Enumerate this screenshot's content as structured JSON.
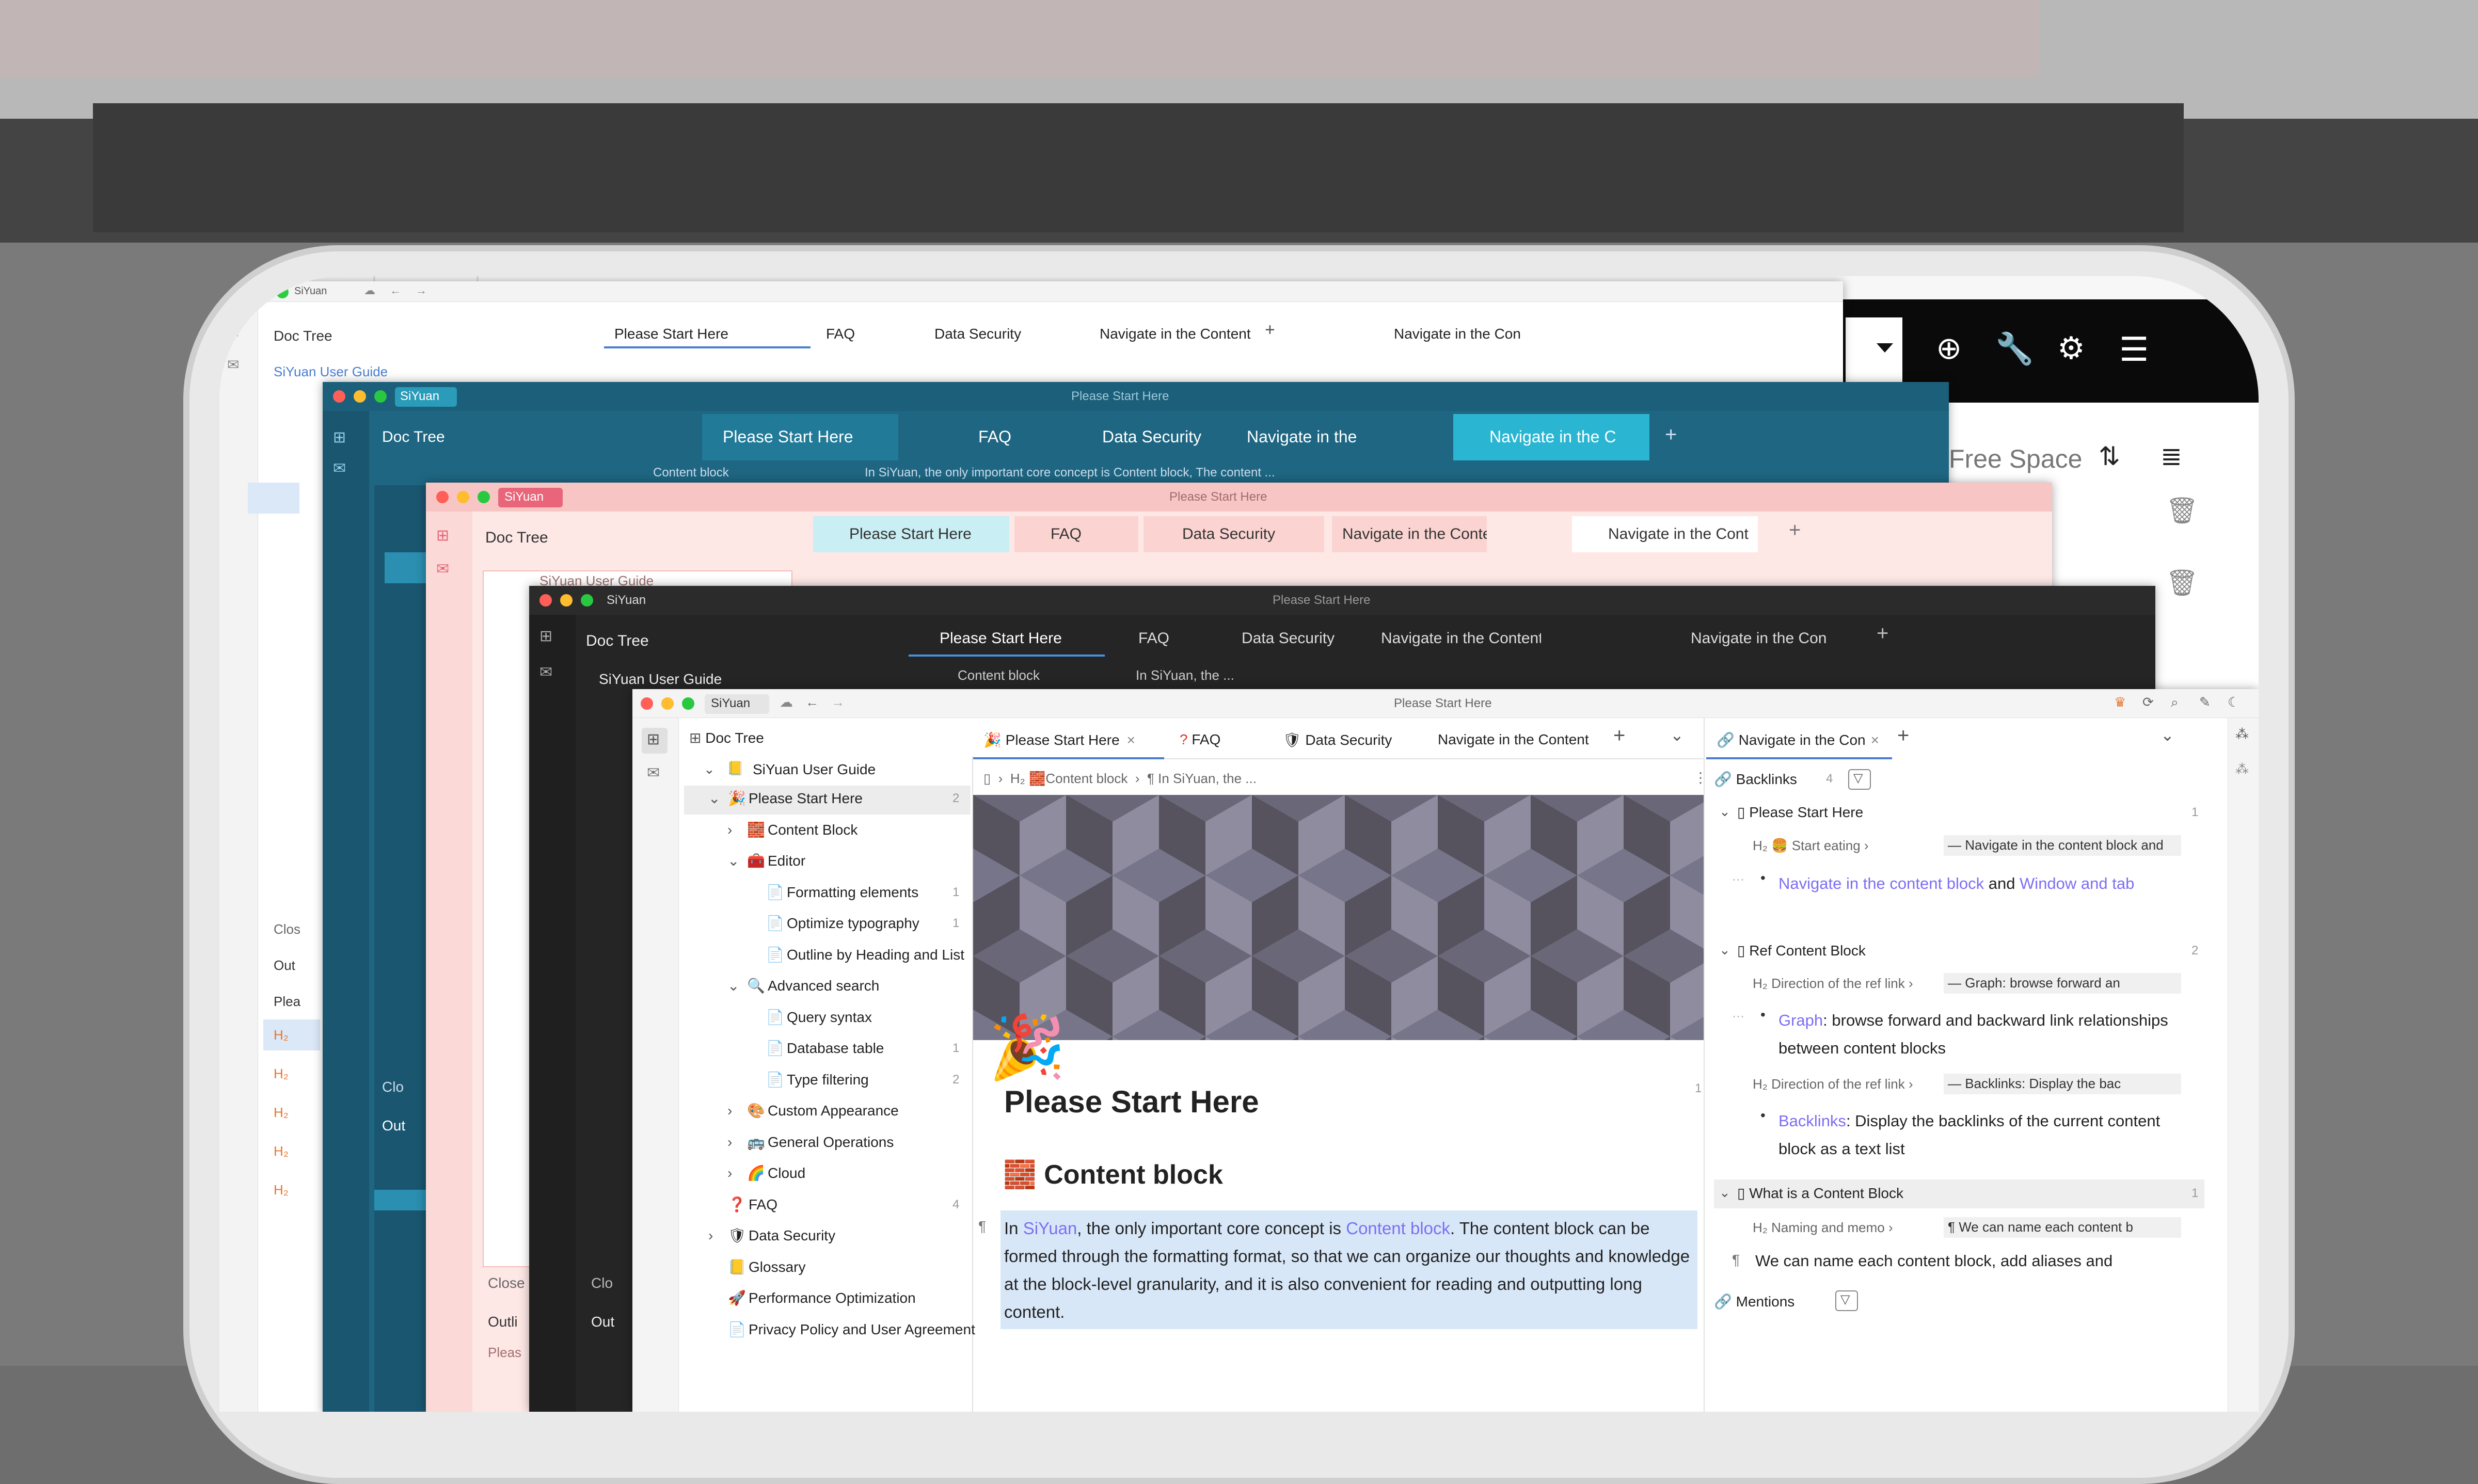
{
  "app": {
    "name": "SiYuan",
    "window_title": "Please Start Here"
  },
  "colors": {
    "teal_theme": "#1c5f7a",
    "pink_theme": "#f7c6c4",
    "dark_theme": "#2b2b2b",
    "light_theme": "#f6f6f6",
    "accent": "#7c6ef5",
    "link": "#7c6ef5",
    "heading_orange": "#e8762d"
  },
  "icons": {
    "doc_tree": "doc-tree-icon",
    "inbox": "inbox-icon",
    "backlinks": "link-icon",
    "filter": "filter-icon",
    "close": "close-icon",
    "plus": "plus-icon",
    "chevron": "chevron-down-icon",
    "cloud": "cloud-icon",
    "back": "arrow-left-icon",
    "forward": "arrow-right-icon",
    "search": "search-icon",
    "pen": "pen-icon",
    "moon": "moon-icon",
    "crown": "crown-icon",
    "sync": "sync-icon",
    "settings": "gear-icon",
    "wrench": "wrench-icon",
    "menu": "menu-icon"
  },
  "common": {
    "doc_tree": "Doc Tree",
    "siyuan": "SiYuan",
    "user_guide": "SiYuan User Guide",
    "close_label": "Close",
    "outline": "Outline",
    "please_abbrev": "Plea",
    "please": "Please",
    "pleas": "Pleas",
    "close_short": "Clos",
    "out": "Out",
    "outli": "Outli",
    "clo": "Clo"
  },
  "tabs": {
    "start": "Please Start Here",
    "faq": "FAQ",
    "security": "Data Security",
    "navigate": "Navigate in the Content",
    "navigate_short": "Navigate in the Con",
    "navigate_mid": "Navigate in the Cont",
    "navigate_c": "Navigate in the C",
    "navigate_the": "Navigate in the"
  },
  "breadcrumb": {
    "content_block": "Content block",
    "in_siyuan": "In SiYuan, the ...",
    "in_siyuan_long": "In SiYuan, the only important core concept is Content block, The content ...",
    "in_siyuan_cut": "In SiYuan, the",
    "backlinks_cut": "Backlinks"
  },
  "right_panel_bg": {
    "free_space": "Free Space"
  },
  "doc_tree": {
    "root": "SiYuan User Guide",
    "items": [
      {
        "label": "Please Start Here",
        "count": "2",
        "level": 1,
        "icon": "🎉",
        "open": true,
        "selected": true
      },
      {
        "label": "Content Block",
        "count": "",
        "level": 2,
        "icon": "🧱",
        "open": false
      },
      {
        "label": "Editor",
        "count": "",
        "level": 2,
        "icon": "🧰",
        "open": true
      },
      {
        "label": "Formatting elements",
        "count": "1",
        "level": 3,
        "icon": "📄",
        "open": null
      },
      {
        "label": "Optimize typography",
        "count": "1",
        "level": 3,
        "icon": "📄",
        "open": null
      },
      {
        "label": "Outline by Heading and List",
        "count": "",
        "level": 3,
        "icon": "📄",
        "open": null
      },
      {
        "label": "Advanced search",
        "count": "",
        "level": 2,
        "icon": "🔍",
        "open": true
      },
      {
        "label": "Query syntax",
        "count": "",
        "level": 3,
        "icon": "📄",
        "open": null
      },
      {
        "label": "Database table",
        "count": "1",
        "level": 3,
        "icon": "📄",
        "open": null
      },
      {
        "label": "Type filtering",
        "count": "2",
        "level": 3,
        "icon": "📄",
        "open": null
      },
      {
        "label": "Custom Appearance",
        "count": "",
        "level": 2,
        "icon": "🎨",
        "open": false
      },
      {
        "label": "General Operations",
        "count": "",
        "level": 2,
        "icon": "🚌",
        "open": false
      },
      {
        "label": "Cloud",
        "count": "",
        "level": 2,
        "icon": "🌈",
        "open": false
      },
      {
        "label": "FAQ",
        "count": "4",
        "level": 1,
        "icon": "❓",
        "open": null
      },
      {
        "label": "Data Security",
        "count": "",
        "level": 1,
        "icon": "🛡",
        "open": false
      },
      {
        "label": "Glossary",
        "count": "",
        "level": 1,
        "icon": "📒",
        "open": null
      },
      {
        "label": "Performance Optimization",
        "count": "",
        "level": 1,
        "icon": "🚀",
        "open": null
      },
      {
        "label": "Privacy Policy and User Agreement",
        "count": "",
        "level": 1,
        "icon": "📄",
        "open": null
      }
    ]
  },
  "editor": {
    "title": "Please Start Here",
    "title_count": "1",
    "h2": "Content block",
    "para_count": "1",
    "para_parts": [
      "In ",
      "SiYuan",
      ", the only important core concept is ",
      "Content block",
      ". The content block can be formed through the formatting format, so that we can organize our thoughts and knowledge at the block-level granularity, and it is also convenient for reading and outputting long content."
    ]
  },
  "backlinks": {
    "tab_label": "Navigate in the Con",
    "header": "Backlinks",
    "count": "4",
    "groups": [
      {
        "doc": "Please Start Here",
        "count": "1",
        "crumb_h": "Start eating",
        "crumb_p": "Navigate in the content block and",
        "link1": "Navigate in the content block",
        "mid": " and ",
        "link2": "Window and tab"
      },
      {
        "doc": "Ref Content Block",
        "count": "2",
        "crumb_h": "Direction of the ref link",
        "crumb_p": "Graph: browse forward an",
        "link1": "Graph",
        "rest1": ": browse forward and backward link relationships between content blocks",
        "crumb_h2": "Direction of the ref link",
        "crumb_p2": "Backlinks: Display the bac",
        "link2": "Backlinks",
        "rest2": ": Display the backlinks of the current content block as a text list"
      },
      {
        "doc": "What is a Content Block",
        "count": "1",
        "crumb_h": "Naming and memo",
        "crumb_p": "We can name each content b",
        "para": "We can name each content block, add aliases and"
      }
    ],
    "mentions": "Mentions"
  }
}
